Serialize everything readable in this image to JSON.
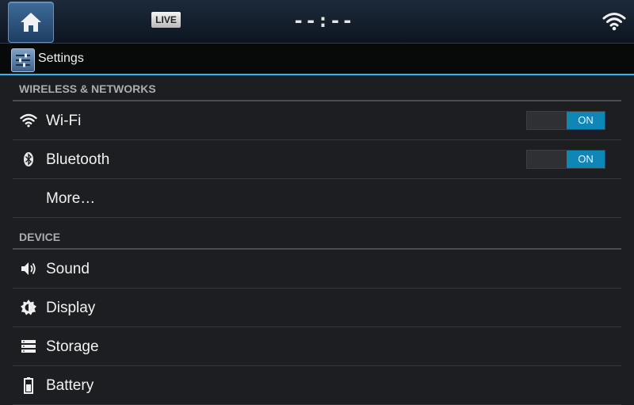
{
  "status_bar": {
    "live_badge": "LIVE",
    "clock": "--:--"
  },
  "action_bar": {
    "title": "Settings"
  },
  "sections": [
    {
      "header": "WIRELESS & NETWORKS",
      "items": [
        {
          "label": "Wi-Fi",
          "icon": "wifi-icon",
          "toggle": "ON"
        },
        {
          "label": "Bluetooth",
          "icon": "bluetooth-icon",
          "toggle": "ON"
        },
        {
          "label": "More…"
        }
      ]
    },
    {
      "header": "DEVICE",
      "items": [
        {
          "label": "Sound",
          "icon": "speaker-icon"
        },
        {
          "label": "Display",
          "icon": "brightness-icon"
        },
        {
          "label": "Storage",
          "icon": "storage-icon"
        },
        {
          "label": "Battery",
          "icon": "battery-icon"
        }
      ]
    }
  ],
  "colors": {
    "accent": "#33b5e5",
    "toggle_on": "#0f86b8",
    "background": "#1c1e22"
  }
}
